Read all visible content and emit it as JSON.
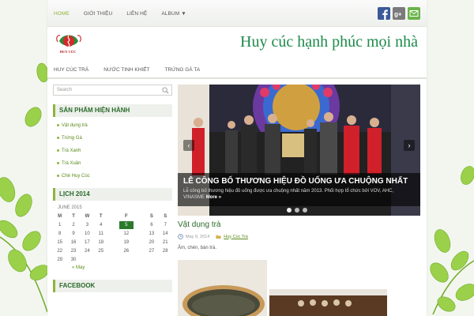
{
  "top_nav": {
    "items": [
      "HOME",
      "GIỚI THIỆU",
      "LIÊN HỆ",
      "ALBUM"
    ],
    "active_index": 0
  },
  "social": [
    {
      "icon": "facebook-icon",
      "color": "#3b5998"
    },
    {
      "icon": "google-plus-icon",
      "color": "#7a7a7a"
    },
    {
      "icon": "email-icon",
      "color": "#6ab44a"
    }
  ],
  "header": {
    "logo_text": "HUY CÚC",
    "site_title": "Huy cúc hạnh phúc mọi nhà"
  },
  "sub_nav": {
    "items": [
      "HUY CÚC TRÀ",
      "NƯỚC TINH KHIẾT",
      "TRỨNG GÀ TA"
    ]
  },
  "sidebar": {
    "search_placeholder": "Search",
    "products": {
      "title": "SẢN PHẨM HIỆN HÀNH",
      "items": [
        "Vật dụng trà",
        "Trứng Gà",
        "Trà Xanh",
        "Trà Xuân",
        "Chè Huy Cúc"
      ]
    },
    "calendar": {
      "title": "LỊCH 2014",
      "caption": "JUNE 2015",
      "weekdays": [
        "M",
        "T",
        "W",
        "T",
        "F",
        "S",
        "S"
      ],
      "weeks": [
        [
          "1",
          "2",
          "3",
          "4",
          "5",
          "6",
          "7"
        ],
        [
          "8",
          "9",
          "10",
          "11",
          "12",
          "13",
          "14"
        ],
        [
          "15",
          "16",
          "17",
          "18",
          "19",
          "20",
          "21"
        ],
        [
          "22",
          "23",
          "24",
          "25",
          "26",
          "27",
          "28"
        ],
        [
          "29",
          "30",
          "",
          "",
          "",
          "",
          ""
        ]
      ],
      "today": "5",
      "prev_link": "« May"
    },
    "facebook": {
      "title": "FACEBOOK"
    }
  },
  "slider": {
    "title": "LỄ CÔNG BỐ THƯƠNG HIỆU ĐỒ UỐNG ƯA CHUỘNG NHẤT",
    "description": "Lễ công bố thương hiệu đồ uống được ưa chuộng nhất năm 2013. Phối hợp tổ chức bởi VOV, AHC, VINASME",
    "more": "More »",
    "dots": 3,
    "active_dot": 0
  },
  "post": {
    "title": "Vật dụng trà",
    "date": "May 9, 2014",
    "category": "Huy Cúc Trà",
    "excerpt": "Ấm, chén, bàn trà."
  }
}
